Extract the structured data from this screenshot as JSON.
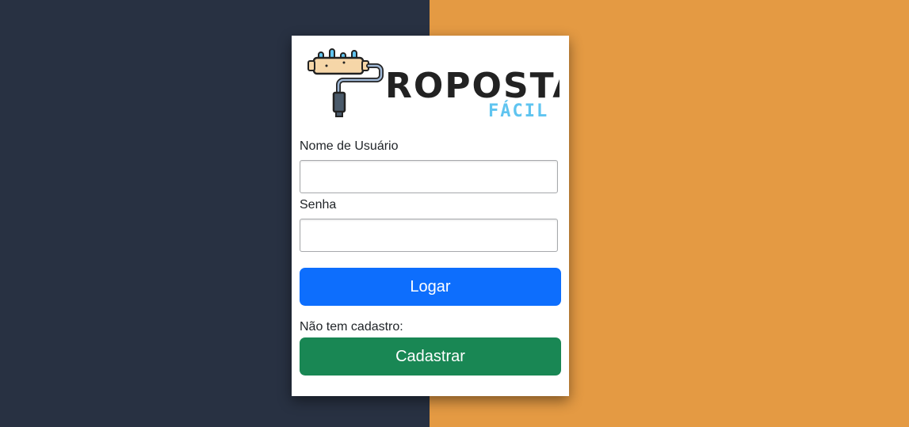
{
  "colors": {
    "left_background": "#283142",
    "right_background": "#e49a43",
    "primary": "#0d6efd",
    "success": "#198754",
    "logo_text": "#222222",
    "logo_accent": "#5fc4f0"
  },
  "logo": {
    "icon": "paint-roller-icon",
    "word_main": "ROPOSTA",
    "word_sub": "FÁCIL"
  },
  "form": {
    "username_label": "Nome de Usuário",
    "username_value": "",
    "password_label": "Senha",
    "password_value": "",
    "login_label": "Logar",
    "signup_prompt": "Não tem cadastro:",
    "signup_label": "Cadastrar"
  }
}
